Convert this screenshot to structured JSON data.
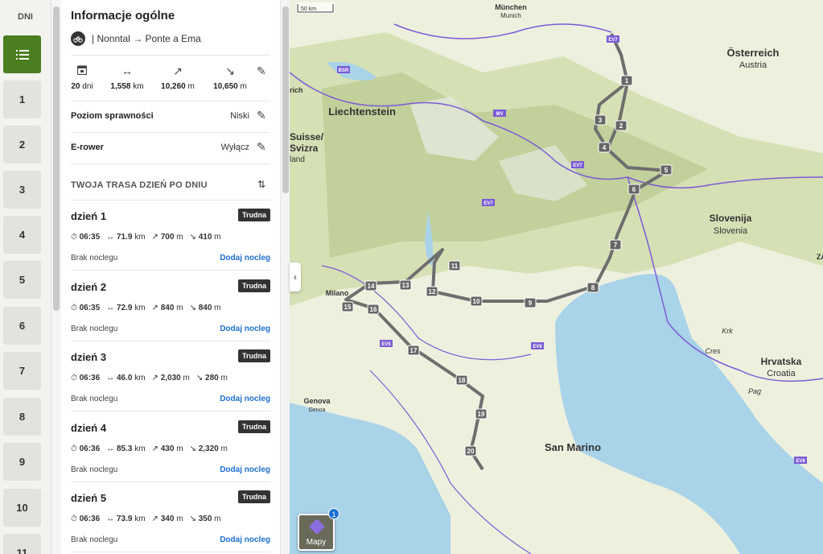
{
  "rail": {
    "title": "DNI",
    "days": [
      "1",
      "2",
      "3",
      "4",
      "5",
      "6",
      "7",
      "8",
      "9",
      "10",
      "11"
    ]
  },
  "panel": {
    "title": "Informacje ogólne",
    "route": "| Nonntal → Ponte a Ema",
    "stats": {
      "days": "20",
      "days_unit": "dni",
      "distance": "1,558",
      "distance_unit": "km",
      "ascent": "10,260",
      "ascent_unit": "m",
      "descent": "10,650",
      "descent_unit": "m"
    },
    "fitness": {
      "label": "Poziom sprawności",
      "value": "Niski"
    },
    "ebike": {
      "label": "E-rower",
      "value": "Wyłącz"
    },
    "section_title": "TWOJA TRASA DZIEŃ PO DNIU",
    "day_items": [
      {
        "name": "dzień 1",
        "badge": "Trudna",
        "time": "06:35",
        "distance": "71.9",
        "ascent": "700",
        "descent": "410",
        "lodging": "Brak noclegu",
        "add": "Dodaj nocleg"
      },
      {
        "name": "dzień 2",
        "badge": "Trudna",
        "time": "06:35",
        "distance": "72.9",
        "ascent": "840",
        "descent": "840",
        "lodging": "Brak noclegu",
        "add": "Dodaj nocleg"
      },
      {
        "name": "dzień 3",
        "badge": "Trudna",
        "time": "06:36",
        "distance": "46.0",
        "ascent": "2,030",
        "descent": "280",
        "lodging": "Brak noclegu",
        "add": "Dodaj nocleg"
      },
      {
        "name": "dzień 4",
        "badge": "Trudna",
        "time": "06:36",
        "distance": "85.3",
        "ascent": "430",
        "descent": "2,320",
        "lodging": "Brak noclegu",
        "add": "Dodaj nocleg"
      },
      {
        "name": "dzień 5",
        "badge": "Trudna",
        "time": "06:36",
        "distance": "73.9",
        "ascent": "340",
        "descent": "350",
        "lodging": "Brak noclegu",
        "add": "Dodaj nocleg"
      }
    ],
    "units": {
      "km": "km",
      "m": "m"
    }
  },
  "map": {
    "scale": "50 km",
    "labels": {
      "munchen": "München",
      "munich": "Munich",
      "osterreich": "Österreich",
      "austria": "Austria",
      "liechtenstein": "Liechtenstein",
      "suisse": "Suisse/",
      "svizra": "Svizra",
      "land": "land",
      "rich": "rich",
      "slovenija": "Slovenija",
      "slovenia": "Slovenia",
      "hrvatska": "Hrvatska",
      "croatia": "Croatia",
      "krk": "Krk",
      "cres": "Cres",
      "pag": "Pag",
      "genova": "Genova",
      "genoa": "Genoa",
      "sanmarino": "San Marino",
      "milano": "Milano",
      "za": "ZA",
      "ev7a": "EV7",
      "ev7b": "EV7",
      "ev7c": "EV7",
      "ev8a": "EV8",
      "ev8b": "EV8",
      "ev5": "EV5",
      "bsr": "BSR",
      "mv": "MV"
    },
    "stage_labels": [
      "1",
      "2",
      "3",
      "4",
      "5",
      "6",
      "7",
      "8",
      "9",
      "10",
      "11",
      "12",
      "13",
      "14",
      "15",
      "16",
      "17",
      "18",
      "19",
      "20"
    ],
    "layers_button": "Mapy",
    "layers_badge": "1"
  },
  "colors": {
    "accent": "#4a7e1f",
    "link": "#1c6fd1",
    "route": "#6e6e6e",
    "border_line": "#7b5cd6",
    "sea": "#a9d3e8"
  }
}
